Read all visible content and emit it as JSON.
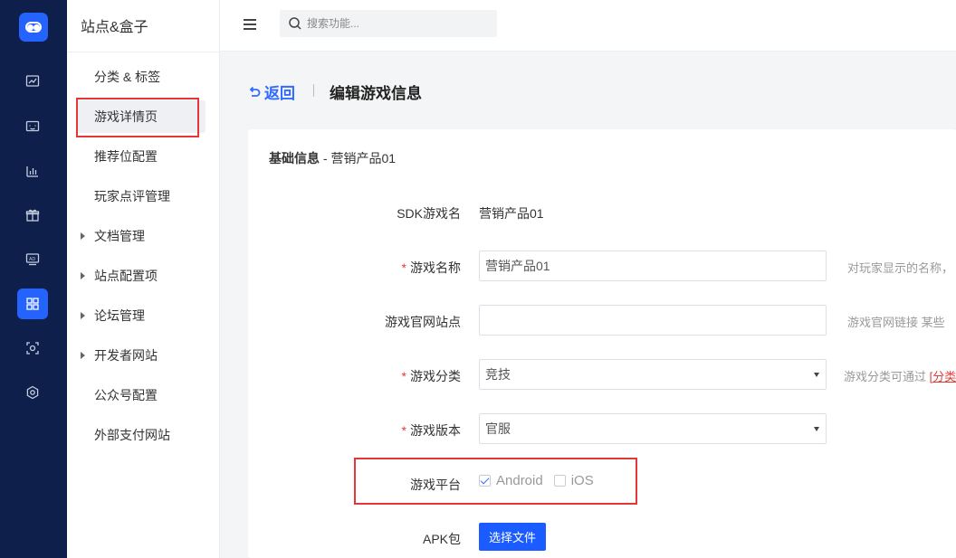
{
  "sidebar": {
    "title": "站点&盒子",
    "items": [
      {
        "label": "分类 & 标签"
      },
      {
        "label": "游戏详情页"
      },
      {
        "label": "推荐位配置"
      },
      {
        "label": "玩家点评管理"
      },
      {
        "label": "文档管理"
      },
      {
        "label": "站点配置项"
      },
      {
        "label": "论坛管理"
      },
      {
        "label": "开发者网站"
      },
      {
        "label": "公众号配置"
      },
      {
        "label": "外部支付网站"
      }
    ]
  },
  "topbar": {
    "search_placeholder": "搜索功能..."
  },
  "header": {
    "back_label": "返回",
    "title": "编辑游戏信息"
  },
  "section": {
    "title_bold": "基础信息",
    "title_rest": " - 营销产品01"
  },
  "form": {
    "sdk_label": "SDK游戏名",
    "sdk_value": "营销产品01",
    "name_label": "游戏名称",
    "name_value": "营销产品01",
    "name_hint": "对玩家显示的名称，",
    "site_label": "游戏官网站点",
    "site_value": "",
    "site_hint": "游戏官网链接 某些",
    "category_label": "游戏分类",
    "category_value": "竞技",
    "category_hint": "游戏分类可通过",
    "category_hint_link": "[分类",
    "version_label": "游戏版本",
    "version_value": "官服",
    "platform_label": "游戏平台",
    "platform_android": "Android",
    "platform_ios": "iOS",
    "apk_label": "APK包",
    "apk_button": "选择文件"
  },
  "colors": {
    "rail_bg": "#0d1f4a",
    "accent": "#1a5cff",
    "highlight": "#e3373a"
  }
}
